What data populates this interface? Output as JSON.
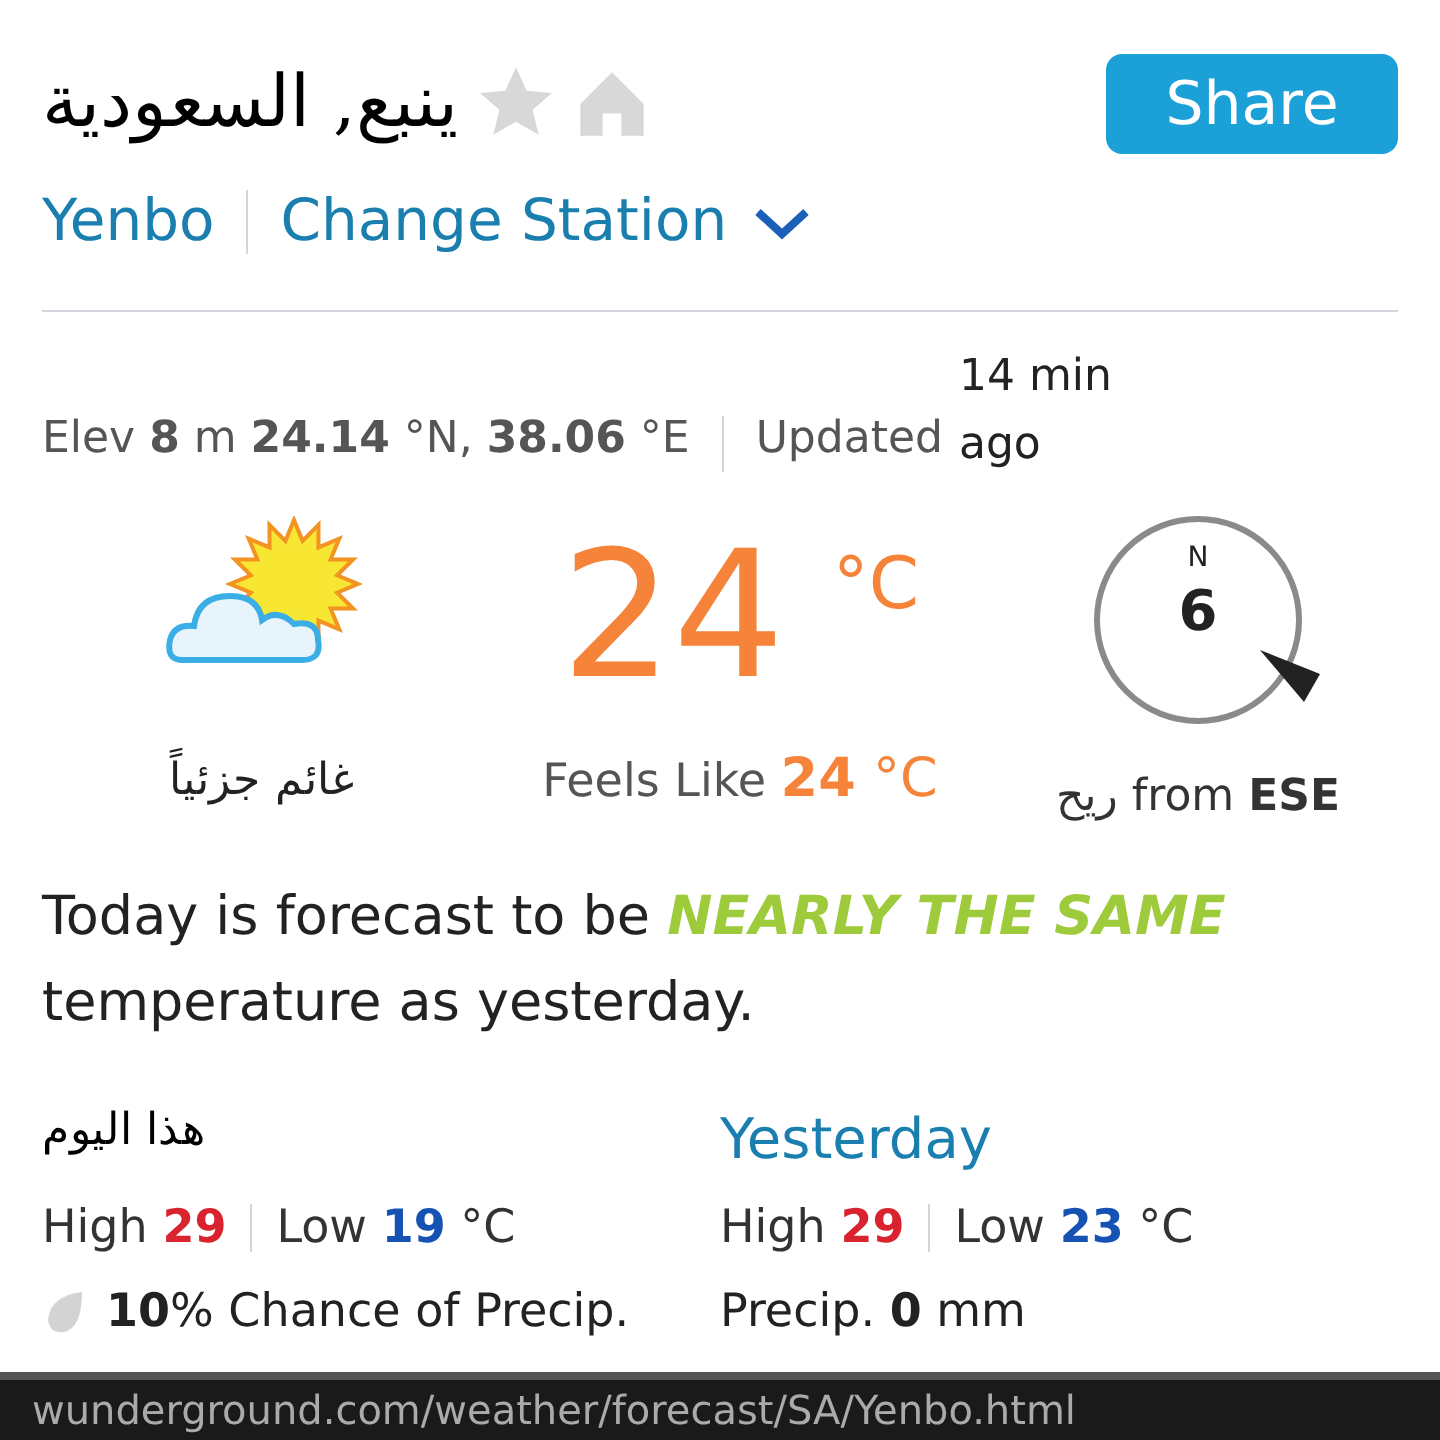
{
  "header": {
    "title": "ينبع, السعودية",
    "share": "Share",
    "station": "Yenbo",
    "change_station": "Change Station"
  },
  "info": {
    "location": "Elev **8** m **24.14** °N, **38.06** °E",
    "updated_label": "Updated",
    "updated_value": "14 min ago"
  },
  "current": {
    "condition": "غائم جزئياً",
    "temperature": "24",
    "unit": "°C",
    "feels_like_label": "Feels Like",
    "feels_like": "24 °C",
    "wind_speed": "6",
    "compass_north": "N",
    "wind_label": "ريح from",
    "wind_direction": "ESE"
  },
  "forecast": {
    "before": "Today is forecast to be",
    "highlight": "NEARLY THE SAME",
    "after": "temperature as yesterday."
  },
  "days": [
    {
      "title": "هذا اليوم",
      "kind": "today",
      "high_label": "High",
      "high": "29",
      "low_label": "Low",
      "low": "19",
      "unit": "°C",
      "precip": "**10**% Chance of Precip."
    },
    {
      "title": "Yesterday",
      "kind": "past",
      "high_label": "High",
      "high": "29",
      "low_label": "Low",
      "low": "23",
      "unit": "°C",
      "precip": "Precip. **0** mm"
    }
  ],
  "status_bar": {
    "url": "wunderground.com/weather/forecast/SA/Yenbo.html"
  }
}
